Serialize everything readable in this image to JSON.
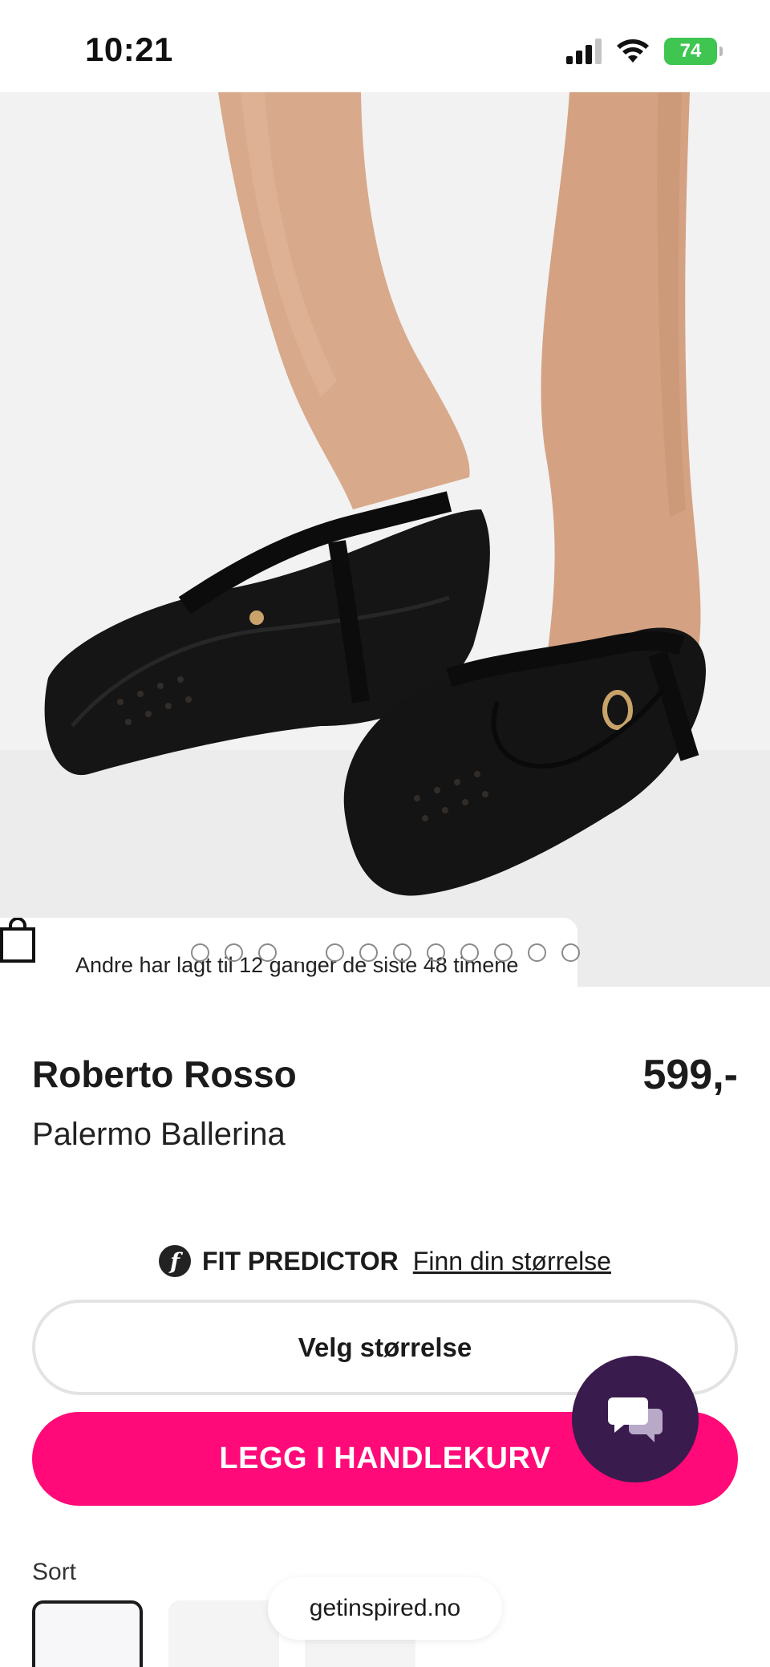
{
  "status_bar": {
    "time": "10:21",
    "battery": "74"
  },
  "product_image": {
    "popularity_text": "Andre har lagt til 12 ganger de siste 48 timene",
    "carousel_total": 12,
    "carousel_active_index": 4
  },
  "product": {
    "brand": "Roberto Rosso",
    "price": "599,-",
    "name": "Palermo Ballerina"
  },
  "fit_predictor": {
    "logo_letter": "f",
    "label": "FIT PREDICTOR",
    "link": "Finn din størrelse"
  },
  "size_select": {
    "label": "Velg størrelse"
  },
  "cart": {
    "button_label": "LEGG I HANDLEKURV"
  },
  "color": {
    "label": "Sort"
  },
  "browser": {
    "url": "getinspired.no"
  },
  "colors": {
    "accent_pink": "#ff0a78",
    "chat_purple": "#3a1b4d",
    "battery_green": "#3fc651"
  },
  "icons": [
    "signal-icon",
    "wifi-icon",
    "battery-icon",
    "shopping-bag-icon",
    "fit-predictor-logo-icon",
    "chat-icon"
  ]
}
